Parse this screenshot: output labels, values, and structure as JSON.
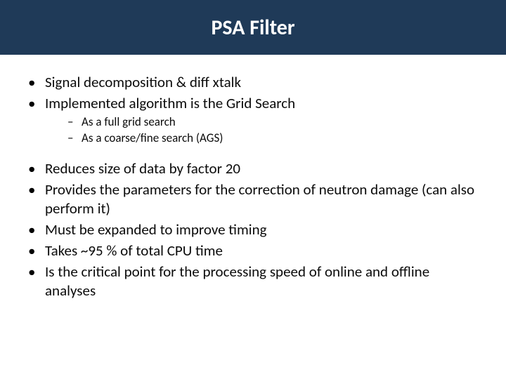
{
  "title": "PSA Filter",
  "bullets": {
    "b1": "Signal decomposition & diff xtalk",
    "b2": "Implemented algorithm is the Grid Search",
    "b2_sub": {
      "s1": "As a full grid search",
      "s2": "As a coarse/fine search (AGS)"
    },
    "b3": "Reduces size of data by factor 20",
    "b4": "Provides the parameters for the correction of neutron damage (can also perform it)",
    "b5": "Must be expanded to improve timing",
    "b6": "Takes ~95 % of total CPU time",
    "b7": "Is the critical point for the processing speed of online and offline analyses"
  }
}
